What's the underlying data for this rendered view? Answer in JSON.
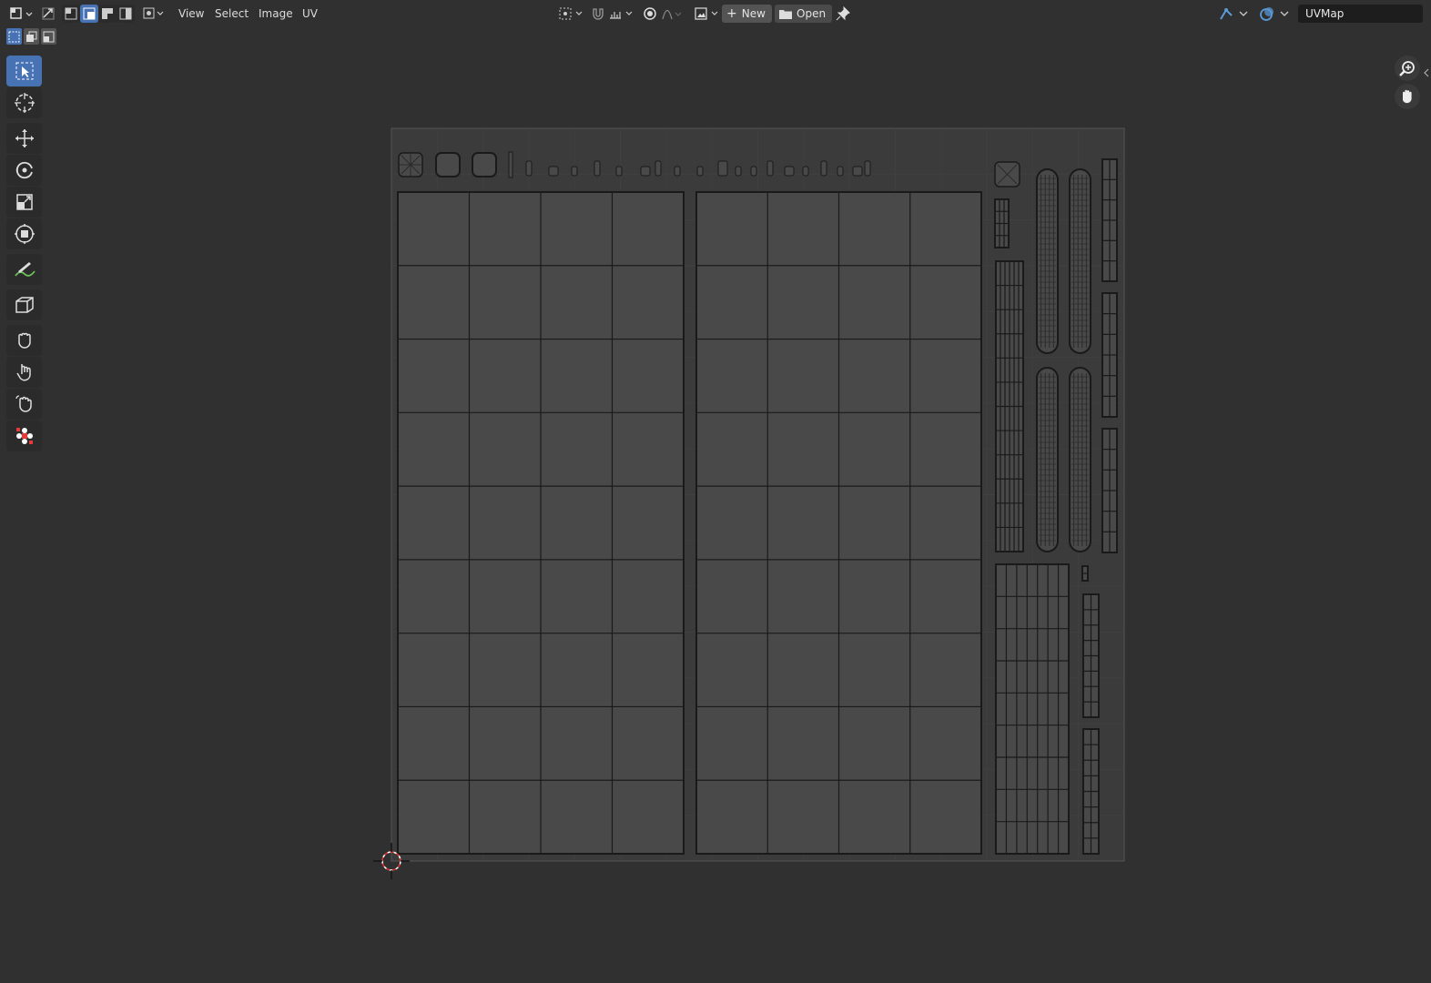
{
  "header": {
    "menus": [
      "View",
      "Select",
      "Image",
      "UV"
    ],
    "new_label": "New",
    "open_label": "Open",
    "uvmap_name": "UVMap"
  },
  "icons": {
    "editor_type": "uv-editor-icon",
    "sync_selection": "sync-selection-icon",
    "select_modes": [
      "vertex-select-icon",
      "edge-select-icon",
      "face-select-icon"
    ],
    "toolbar": [
      "select-box-icon",
      "cursor-icon",
      "move-icon",
      "rotate-icon",
      "scale-icon",
      "transform-icon",
      "annotate-icon",
      "rip-icon",
      "grab-icon",
      "relax-icon",
      "pinch-icon",
      "sample-icon"
    ]
  },
  "colors": {
    "background": "#303030",
    "accent": "#4772b3",
    "uv_face": "#494949",
    "uv_edge": "#1a1a1a"
  }
}
